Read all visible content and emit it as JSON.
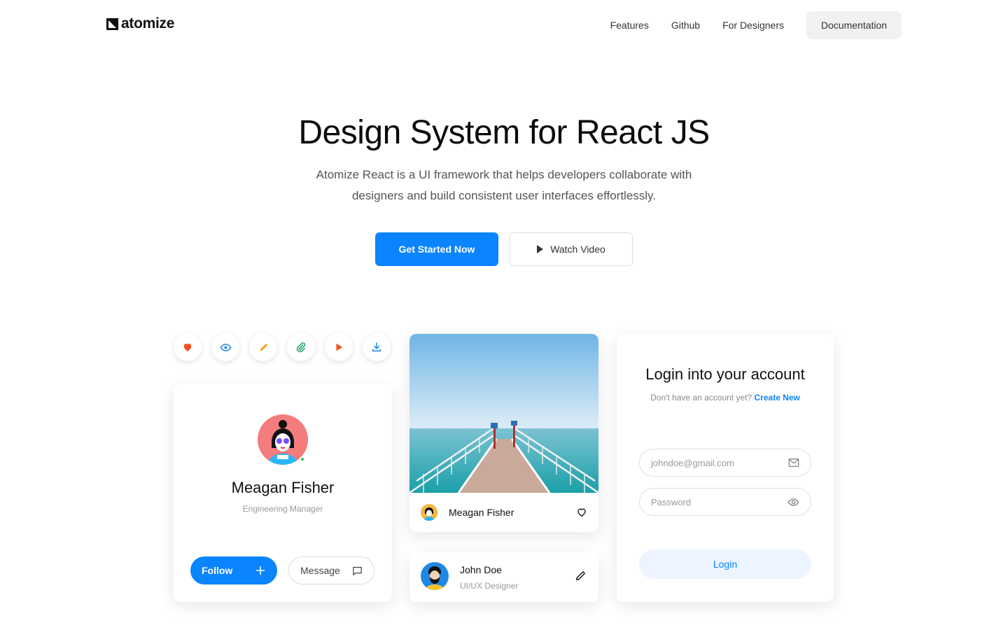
{
  "brand": {
    "name": "atomize"
  },
  "nav": {
    "links": [
      "Features",
      "Github",
      "For Designers"
    ],
    "cta": "Documentation"
  },
  "hero": {
    "title": "Design System for React JS",
    "subtitle": "Atomize React is a UI framework that helps developers collaborate with designers and build consistent user interfaces effortlessly.",
    "primary_button": "Get Started Now",
    "secondary_button": "Watch Video"
  },
  "icon_row": [
    {
      "icon": "heart-icon",
      "color": "#f4511e"
    },
    {
      "icon": "eye-icon",
      "color": "#1e88e5"
    },
    {
      "icon": "pencil-icon",
      "color": "#f5a623"
    },
    {
      "icon": "paperclip-icon",
      "color": "#22a06b"
    },
    {
      "icon": "play-icon",
      "color": "#f4511e"
    },
    {
      "icon": "download-icon",
      "color": "#1e88e5"
    }
  ],
  "profile_card": {
    "name": "Meagan Fisher",
    "role": "Engineering Manager",
    "follow_label": "Follow",
    "message_label": "Message"
  },
  "photo_card": {
    "name": "Meagan Fisher"
  },
  "user_card": {
    "name": "John Doe",
    "role": "UI/UX Designer"
  },
  "login_card": {
    "title": "Login into your account",
    "subtitle": "Don't have an account yet?",
    "create_link": "Create New",
    "email_placeholder": "johndoe@gmail.com",
    "password_placeholder": "Password",
    "login_button": "Login"
  },
  "colors": {
    "accent": "#0a84ff",
    "secondary_bg": "#f0f1f3",
    "login_button_bg": "#ebf4ff"
  }
}
